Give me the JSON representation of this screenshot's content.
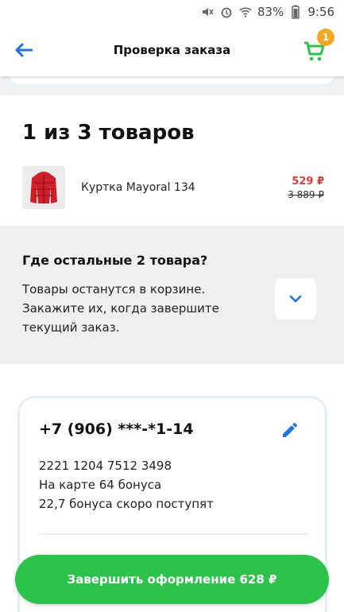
{
  "statusbar": {
    "battery_percent": "83%",
    "time": "9:56"
  },
  "appbar": {
    "title": "Проверка заказа",
    "cart_count": "1"
  },
  "items": {
    "title": "1 из 3 товаров",
    "product": {
      "name": "Куртка Mayoral 134",
      "price_new": "529 ₽",
      "price_old": "3 889 ₽"
    }
  },
  "others": {
    "title": "Где остальные 2 товара?",
    "line1": "Товары останутся в корзине.",
    "line2": "Закажите их, когда завершите",
    "line3": "текущий заказ."
  },
  "account": {
    "phone": "+7 (906) ***-*1-14",
    "card_number": "2221 1204 7512 3498",
    "bonus_on_card": "На карте 64 бонуса",
    "bonus_pending": "22,7 бонуса скоро поступят"
  },
  "checkout": {
    "label": "Завершить оформление 628 ₽"
  },
  "colors": {
    "accent_blue": "#1a73e8",
    "green": "#2bc34a",
    "badge_orange": "#f5a623",
    "price_red": "#e53935"
  }
}
